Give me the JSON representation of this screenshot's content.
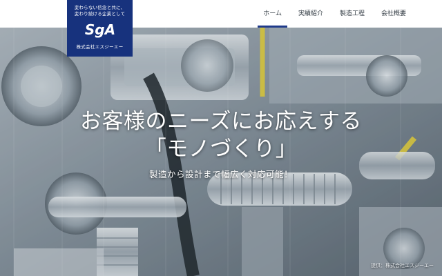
{
  "logo": {
    "tagline_1": "変わらない信念と共に、",
    "tagline_2": "変わり続ける企業として",
    "mark": "SgA",
    "company": "株式会社エスジーエー"
  },
  "nav": {
    "items": [
      {
        "label": "ホーム",
        "active": true
      },
      {
        "label": "実績紹介",
        "active": false
      },
      {
        "label": "製造工程",
        "active": false
      },
      {
        "label": "会社概要",
        "active": false
      }
    ]
  },
  "hero": {
    "headline_1": "お客様のニーズにお応えする",
    "headline_2": "「モノづくり」",
    "subheadline": "製造から設計まで幅広く対応可能！",
    "credit": "提供：株式会社エスジーエー"
  },
  "colors": {
    "brand": "#17327d",
    "accent_underline": "#1f3a8a",
    "cable_yellow": "#e8d23a"
  }
}
